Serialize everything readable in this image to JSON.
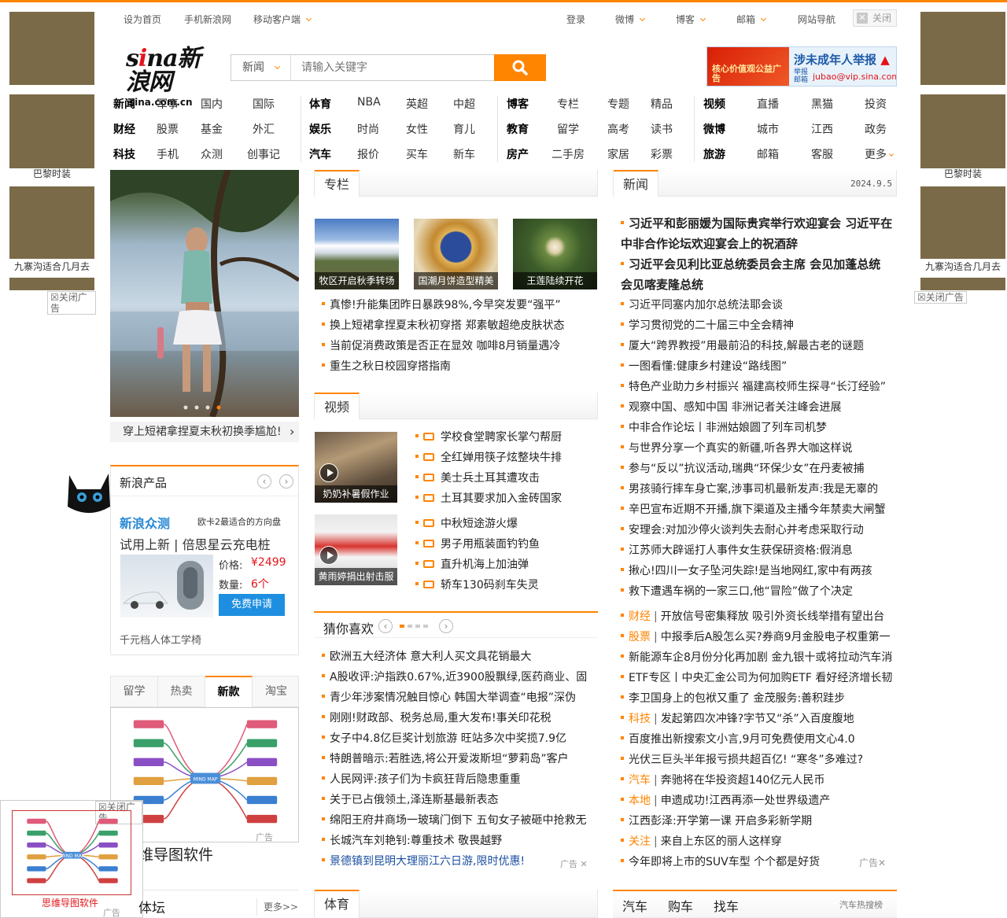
{
  "topbar": {
    "items": [
      "设为首页",
      "手机新浪网",
      "移动客户端"
    ],
    "right": [
      "登录",
      "微博",
      "博客",
      "邮箱",
      "网站导航"
    ],
    "close": "关闭"
  },
  "side_ads": {
    "captions": [
      "巴黎时装",
      "九寨沟适合几月去"
    ],
    "close": "关闭广告"
  },
  "logo": {
    "main_a": "s",
    "main_b": "i",
    "main_c": "na新浪网",
    "sub": "sina.com.cn"
  },
  "search": {
    "category": "新闻",
    "placeholder": "请输入关键字"
  },
  "ad_banner": {
    "left": "核心价值观公益广告",
    "title": "涉未成年人举报",
    "sub": "举报邮箱",
    "email": "jubao@vip.sina.com"
  },
  "nav": [
    {
      "rows": [
        [
          "新闻",
          "军事",
          "国内",
          "国际"
        ],
        [
          "财经",
          "股票",
          "基金",
          "外汇"
        ],
        [
          "科技",
          "手机",
          "众测",
          "创事记"
        ]
      ]
    },
    {
      "rows": [
        [
          "体育",
          "NBA",
          "英超",
          "中超"
        ],
        [
          "娱乐",
          "时尚",
          "女性",
          "育儿"
        ],
        [
          "汽车",
          "报价",
          "买车",
          "新车"
        ]
      ]
    },
    {
      "rows": [
        [
          "博客",
          "专栏",
          "专题",
          "精品"
        ],
        [
          "教育",
          "留学",
          "高考",
          "读书"
        ],
        [
          "房产",
          "二手房",
          "家居",
          "彩票"
        ]
      ]
    },
    {
      "rows": [
        [
          "视频",
          "直播",
          "黑猫",
          "投资"
        ],
        [
          "微博",
          "城市",
          "江西",
          "政务"
        ],
        [
          "旅游",
          "邮箱",
          "客服",
          "更多"
        ]
      ]
    }
  ],
  "carousel": {
    "caption": "穿上短裙拿捏夏末秋初换季尴尬!"
  },
  "product": {
    "title": "新浪产品",
    "brand": "新浪众测",
    "brand_note": "欧卡2最适合的方向盘",
    "headline": "试用上新 | 倍思星云充电桩",
    "price_label": "价格:",
    "price": "¥2499",
    "qty_label": "数量:",
    "qty": "6个",
    "apply": "免费申请",
    "footer": "千元档人体工学椅"
  },
  "tabs4": [
    "留学",
    "热卖",
    "新款",
    "淘宝"
  ],
  "mindmap": {
    "center": "MIND MAP",
    "caption": "思维导图软件",
    "partial_caption": "维导图软件",
    "close": "关闭广告",
    "ad": "广告"
  },
  "lower_left": {
    "title": "体坛",
    "more": "更多>>"
  },
  "zhuanlan": {
    "title": "专栏",
    "thumbs": [
      "牧区开启秋季转场",
      "国潮月饼造型精美",
      "王莲陆续开花"
    ],
    "items": [
      "真惨!升能集团昨日暴跌98%,今早突发要“强平”",
      "换上短裙拿捏夏末秋初穿搭 郑素敏超绝皮肤状态",
      "当前促消费政策是否正在显效 咖啡8月销量遇冷",
      "重生之秋日校园穿搭指南"
    ]
  },
  "video": {
    "title": "视频",
    "thumbs": [
      "奶奶补暑假作业",
      "黄雨婷捐出射击服"
    ],
    "group1": [
      "学校食堂聘家长掌勺帮厨",
      "全红婵用筷子炫整块牛排",
      "美士兵土耳其遭攻击",
      "土耳其要求加入金砖国家"
    ],
    "group2": [
      "中秋短途游火爆",
      "男子用瓶装面钓钓鱼",
      "直升机海上加油弹",
      "轿车130码刹车失灵"
    ]
  },
  "guess": {
    "title": "猜你喜欢",
    "items": [
      "欧洲五大经济体 意大利人买文具花销最大",
      "A股收评:沪指跌0.67%,近3900股飘绿,医药商业、固",
      "青少年涉案情况触目惊心 韩国大举调查“电报”深伪",
      "刚刚!财政部、税务总局,重大发布!事关印花税",
      "女子中4.8亿巨奖计划旅游 旺站多次中奖揽7.9亿",
      "特朗普暗示:若胜选,将公开爱泼斯坦“萝莉岛”客户",
      "人民网评:孩子们为卡疯狂背后隐患重重",
      "关于已占俄领土,泽连斯基最新表态",
      "绵阳王府井商场一玻璃门倒下 五旬女子被砸中抢救无",
      "长城汽车刘艳钊:尊重技术 敬畏越野",
      "景德镇到昆明大理丽江六日游,限时优惠!"
    ],
    "ad": "广告"
  },
  "sports": {
    "title": "体育"
  },
  "news": {
    "title": "新闻",
    "date": "2024.9.5",
    "headlines": [
      "习近平和彭丽媛为国际贵宾举行欢迎宴会 习近平在",
      "中非合作论坛欢迎宴会上的祝酒辞",
      "习近平会见利比亚总统委员会主席 会见加蓬总统",
      "会见喀麦隆总统"
    ],
    "items": [
      "习近平同塞内加尔总统法耶会谈",
      "学习贯彻党的二十届三中全会精神",
      "厦大“跨界教授”用最前沿的科技,解最古老的谜题",
      "一图看懂:健康乡村建设“路线图”",
      "特色产业助力乡村振兴 福建高校师生探寻“长汀经验”",
      "观察中国、感知中国 非洲记者关注峰会进展",
      "中非合作论坛丨非洲姑娘圆了列车司机梦",
      "与世界分享一个真实的新疆,听各界大咖这样说",
      "参与“反以”抗议活动,瑞典“环保少女”在丹麦被捕",
      "男孩骑行摔车身亡案,涉事司机最新发声:我是无辜的",
      "辛巴宣布近期不开播,旗下渠道及主播今年禁卖大闸蟹",
      "安理会:对加沙停火谈判失去耐心并考虑采取行动",
      "江苏师大辟谣打人事件女生获保研资格:假消息",
      "揪心!四川一女子坠河失踪!是当地网红,家中有两孩",
      "救下遭遇车祸的一家三口,他“冒险”做了个决定"
    ],
    "cat_items": [
      {
        "cat": "财经",
        "text": "开放信号密集释放 吸引外资长线举措有望出台"
      },
      {
        "cat": "股票",
        "text": "中报季后A股怎么买?券商9月金股电子权重第一"
      },
      {
        "cat": "",
        "text": "新能源车企8月份分化再加剧 金九银十或将拉动汽车消"
      },
      {
        "cat": "",
        "text": "ETF专区丨中央汇金公司为何加购ETF 看好经济增长韧"
      },
      {
        "cat": "",
        "text": "李卫国身上的包袱又重了 金茂服务:善积跬步"
      },
      {
        "cat": "科技",
        "text": "发起第四次冲锋?字节又“杀”入百度腹地"
      },
      {
        "cat": "",
        "text": "百度推出新搜索文小言,9月可免费使用文心4.0"
      },
      {
        "cat": "",
        "text": "光伏三巨头半年报亏损共超百亿! “寒冬”多难过?"
      },
      {
        "cat": "汽车",
        "text": "奔驰将在华投资超140亿元人民币"
      },
      {
        "cat": "本地",
        "text": "申遗成功!江西再添一处世界级遗产"
      },
      {
        "cat": "",
        "text": "江西彭泽:开学第一课 开启多彩新学期"
      },
      {
        "cat": "关注",
        "text": "来自上东区的丽人这样穿"
      },
      {
        "cat": "",
        "text": "今年即将上市的SUV车型 个个都是好货"
      }
    ],
    "ad": "广告"
  },
  "auto": {
    "tabs": [
      "汽车",
      "购车",
      "找车"
    ],
    "right": "汽车热搜榜"
  },
  "colors": {
    "accent": "#ff8400",
    "red": "#e3141a"
  }
}
